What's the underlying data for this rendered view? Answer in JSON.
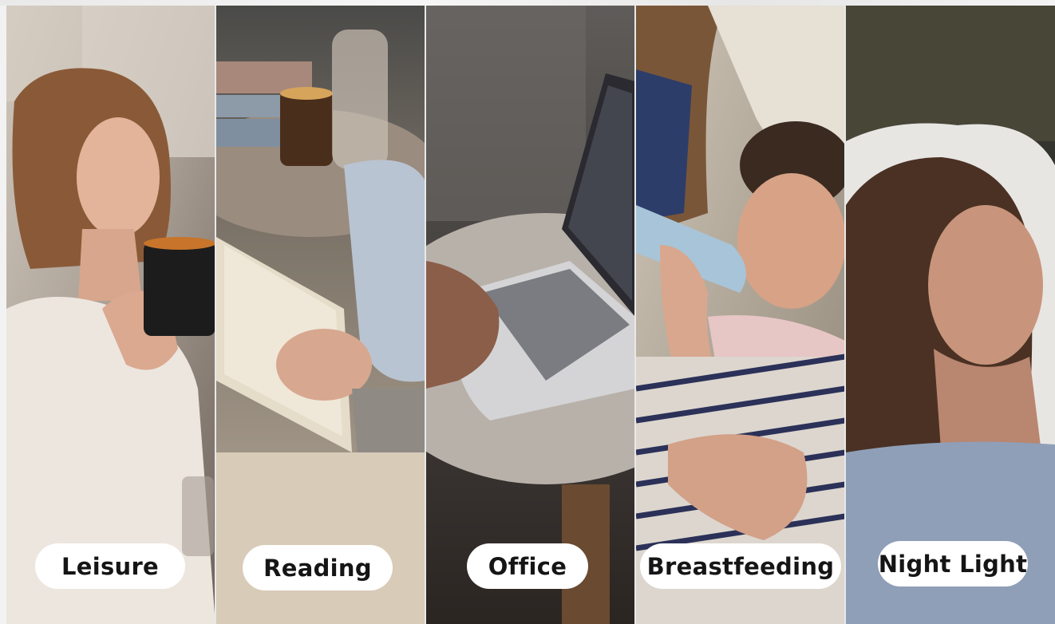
{
  "panels": [
    {
      "id": "leisure",
      "label": "Leisure"
    },
    {
      "id": "reading",
      "label": "Reading"
    },
    {
      "id": "office",
      "label": "Office"
    },
    {
      "id": "breastfeeding",
      "label": "Breastfeeding"
    },
    {
      "id": "night-light",
      "label": "Night Light"
    }
  ],
  "colors": {
    "label_bg": "#ffffff",
    "label_text": "#151515",
    "divider": "#e8e8e8"
  }
}
